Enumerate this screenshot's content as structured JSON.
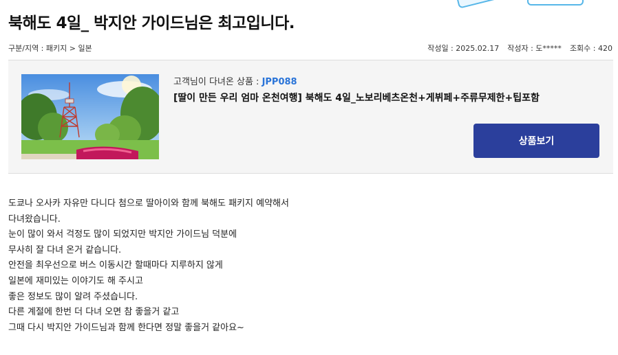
{
  "post": {
    "title": "북해도 4일_ 박지안 가이드님은 최고입니다.",
    "category": "구분/지역 : 패키지 > 일본",
    "date": "작성일 : 2025.02.17",
    "author": "작성자 : 도*****",
    "views": "조회수 : 420"
  },
  "product": {
    "visited_label": "고객님이 다녀온 상품 : ",
    "code": "JPP088",
    "name": "[딸이 만든 우리 엄마 온천여행] 북해도 4일_노보리베츠온천+게뷔페+주류무제한+팁포함",
    "button_label": "상품보기",
    "image_icon": "sapporo-tv-tower-photo"
  },
  "review_lines": [
    "도쿄나 오사카 자유만 다니다 첨으로 딸아이와 함께 북해도 패키지 예약해서",
    "다녀왔습니다.",
    "눈이 많이 와서 걱정도 많이 되었지만 박지안 가이드님 덕분에",
    "무사히 잘 다녀 온거 같습니다.",
    "안전을 최우선으로 버스 이동시간 할때마다 지루하지 않게",
    "일본에 재미있는 이야기도 해 주시고",
    "좋은 정보도 많이 알려 주셨습니다.",
    "다른 계절에 한번 더 다녀 오면 참 좋을거 같고",
    "그때 다시 박지안 가이드님과 함께 한다면 정말 좋을거 같아요~"
  ],
  "colors": {
    "accent": "#2b3f9c",
    "code": "#2a74d8"
  }
}
